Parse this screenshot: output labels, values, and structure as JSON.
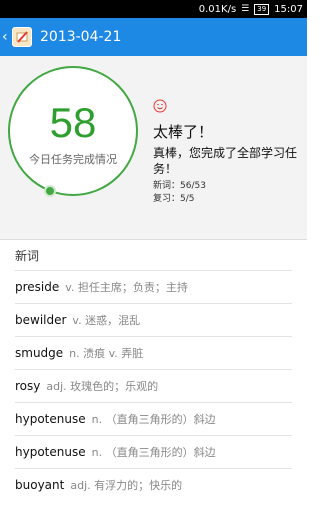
{
  "status_bar": {
    "speed": "0.01K/s",
    "battery": "39",
    "time": "15:07"
  },
  "app_bar": {
    "title": "2013-04-21"
  },
  "summary": {
    "score": "58",
    "caption": "今日任务完成情况",
    "headline": "太棒了！",
    "message": "真棒，您完成了全部学习任务！",
    "new_words": "新词：56/53",
    "review": "复习：5/5",
    "ring_progress": 1.0
  },
  "colors": {
    "accent": "#1e88e5",
    "success": "#2e9f2e",
    "smile": "#e53935"
  },
  "section": {
    "title": "新词"
  },
  "words": [
    {
      "word": "preside",
      "def": "v. 担任主席；负责；主持"
    },
    {
      "word": "bewilder",
      "def": "v. 迷惑，混乱"
    },
    {
      "word": "smudge",
      "def": "n. 渍痕 v. 弄脏"
    },
    {
      "word": "rosy",
      "def": "adj. 玫瑰色的；乐观的"
    },
    {
      "word": "hypotenuse",
      "def": "n. （直角三角形的）斜边"
    },
    {
      "word": "hypotenuse",
      "def": "n. （直角三角形的）斜边"
    },
    {
      "word": "buoyant",
      "def": "adj. 有浮力的；快乐的"
    }
  ]
}
